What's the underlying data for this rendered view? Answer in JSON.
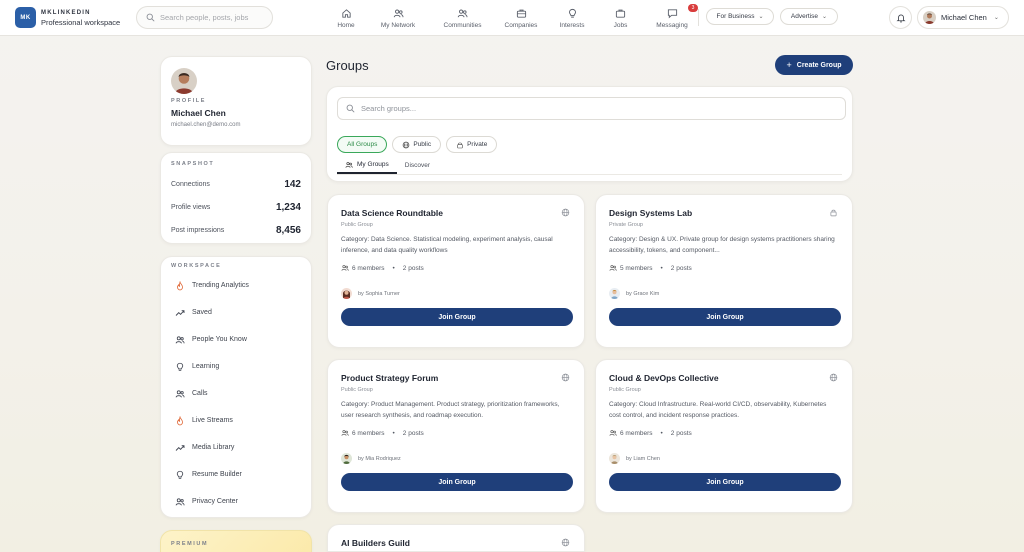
{
  "brand": {
    "logo": "MK",
    "name": "MKLINKEDIN",
    "subtitle": "Professional workspace"
  },
  "search": {
    "placeholder": "Search people, posts, jobs"
  },
  "nav": [
    {
      "label": "Home",
      "icon": "home-icon"
    },
    {
      "label": "My Network",
      "icon": "network-icon"
    },
    {
      "label": "Communities",
      "icon": "communities-icon"
    },
    {
      "label": "Companies",
      "icon": "briefcase-icon"
    },
    {
      "label": "Interests",
      "icon": "lightbulb-icon"
    },
    {
      "label": "Jobs",
      "icon": "jobs-icon"
    },
    {
      "label": "Messaging",
      "icon": "message-icon",
      "badge": "3"
    }
  ],
  "header_buttons": {
    "for_business": "For Business",
    "advertise": "Advertise"
  },
  "user": {
    "name": "Michael Chen"
  },
  "profile": {
    "label": "PROFILE",
    "name": "Michael Chen",
    "email": "michael.chen@demo.com"
  },
  "snapshot": {
    "label": "SNAPSHOT",
    "stats": [
      {
        "label": "Connections",
        "value": "142"
      },
      {
        "label": "Profile views",
        "value": "1,234"
      },
      {
        "label": "Post impressions",
        "value": "8,456"
      }
    ]
  },
  "workspace": {
    "label": "WORKSPACE",
    "items": [
      {
        "label": "Trending Analytics",
        "icon": "flame-icon"
      },
      {
        "label": "Saved",
        "icon": "trending-icon"
      },
      {
        "label": "People You Know",
        "icon": "people-icon"
      },
      {
        "label": "Learning",
        "icon": "lightbulb-icon"
      },
      {
        "label": "Calls",
        "icon": "people-icon"
      },
      {
        "label": "Live Streams",
        "icon": "flame-icon"
      },
      {
        "label": "Media Library",
        "icon": "trending-icon"
      },
      {
        "label": "Resume Builder",
        "icon": "lightbulb-icon"
      },
      {
        "label": "Privacy Center",
        "icon": "people-icon"
      }
    ]
  },
  "premium": {
    "label": "PREMIUM"
  },
  "main": {
    "title": "Groups",
    "create_label": "Create Group",
    "search_placeholder": "Search groups...",
    "filters": [
      "All Groups",
      "Public",
      "Private"
    ],
    "tabs": [
      "My Groups",
      "Discover"
    ],
    "groups": [
      {
        "title": "Data Science Roundtable",
        "type": "Public Group",
        "visibility": "public",
        "description": "Category: Data Science. Statistical modeling, experiment analysis, causal inference, and data quality workflows",
        "members": "6 members",
        "posts": "2 posts",
        "owner": "by Sophia Turner",
        "join": "Join Group"
      },
      {
        "title": "Design Systems Lab",
        "type": "Private Group",
        "visibility": "private",
        "description": "Category: Design & UX. Private group for design systems practitioners sharing accessibility, tokens, and component...",
        "members": "5 members",
        "posts": "2 posts",
        "owner": "by Grace Kim",
        "join": "Join Group"
      },
      {
        "title": "Product Strategy Forum",
        "type": "Public Group",
        "visibility": "public",
        "description": "Category: Product Management. Product strategy, prioritization frameworks, user research synthesis, and roadmap execution.",
        "members": "6 members",
        "posts": "2 posts",
        "owner": "by Mia Rodriquez",
        "join": "Join Group"
      },
      {
        "title": "Cloud & DevOps Collective",
        "type": "Public Group",
        "visibility": "public",
        "description": "Category: Cloud Infrastructure. Real-world CI/CD, observability, Kubernetes cost control, and incident response practices.",
        "members": "6 members",
        "posts": "2 posts",
        "owner": "by Liam Chen",
        "join": "Join Group"
      },
      {
        "title": "AI Builders Guild",
        "type": "",
        "visibility": "public",
        "description": "",
        "members": "",
        "posts": "",
        "owner": "",
        "join": ""
      }
    ]
  },
  "colors": {
    "primary": "#1f3f7a",
    "accent_green": "#3aa85a",
    "badge_red": "#d93c3c",
    "brand_blue": "#2b5fa7"
  }
}
